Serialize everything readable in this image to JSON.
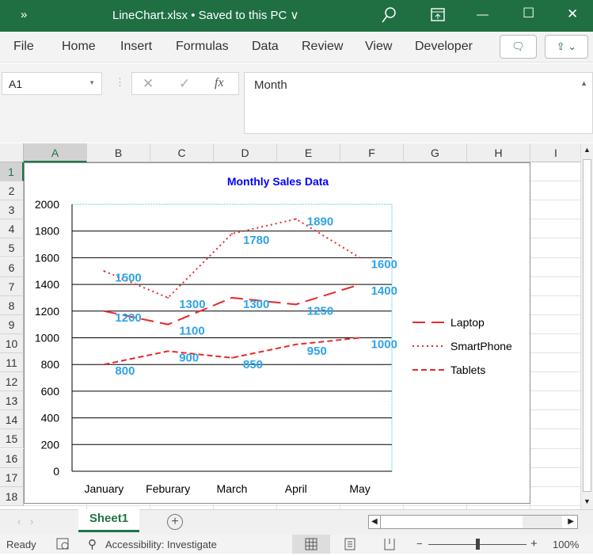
{
  "titlebar": {
    "overflow": "»",
    "title": "LineChart.xlsx • Saved to this PC ∨",
    "search_icon": "search-icon",
    "restore_ribbon_icon": "ribbon-display-icon",
    "minimize": "—",
    "maximize": "☐",
    "close": "✕"
  },
  "menu": [
    "File",
    "Home",
    "Insert",
    "Formulas",
    "Data",
    "Review",
    "View",
    "Developer"
  ],
  "ribbon_buttons": {
    "comments": "🗨",
    "share": "⇪ ⌄"
  },
  "formula_bar": {
    "name_box": "A1",
    "cancel": "✕",
    "enter": "✓",
    "fx": "fx",
    "value": "Month"
  },
  "columns": [
    "A",
    "B",
    "C",
    "D",
    "E",
    "F",
    "G",
    "H",
    "I"
  ],
  "rows": [
    "1",
    "2",
    "3",
    "4",
    "5",
    "6",
    "7",
    "8",
    "9",
    "10",
    "11",
    "12",
    "13",
    "14",
    "15",
    "16",
    "17",
    "18"
  ],
  "chart_data": {
    "type": "line",
    "title": "Monthly Sales Data",
    "categories": [
      "January",
      "Feburary",
      "March",
      "April",
      "May"
    ],
    "ylim": [
      0,
      2000
    ],
    "yticks": [
      "0",
      "200",
      "400",
      "600",
      "800",
      "1000",
      "1200",
      "1400",
      "1600",
      "1800",
      "2000"
    ],
    "grid": true,
    "legend": "right",
    "series": [
      {
        "name": "Laptop",
        "values": [
          1200,
          1100,
          1300,
          1250,
          1400
        ],
        "dash": "long-dash",
        "color": "#e8292a"
      },
      {
        "name": "SmartPhone",
        "values": [
          1500,
          1300,
          1780,
          1890,
          1600
        ],
        "dash": "dotted",
        "color": "#e8292a"
      },
      {
        "name": "Tablets",
        "values": [
          800,
          900,
          850,
          950,
          1000
        ],
        "dash": "dashed",
        "color": "#e8292a"
      }
    ],
    "title_color": "#0000ff",
    "label_color": "#2ea3e8"
  },
  "sheet_tab": "Sheet1",
  "add_sheet": "+",
  "status": {
    "ready": "Ready",
    "accessibility": "Accessibility: Investigate",
    "zoom": "100%",
    "minus": "−",
    "plus": "+"
  }
}
